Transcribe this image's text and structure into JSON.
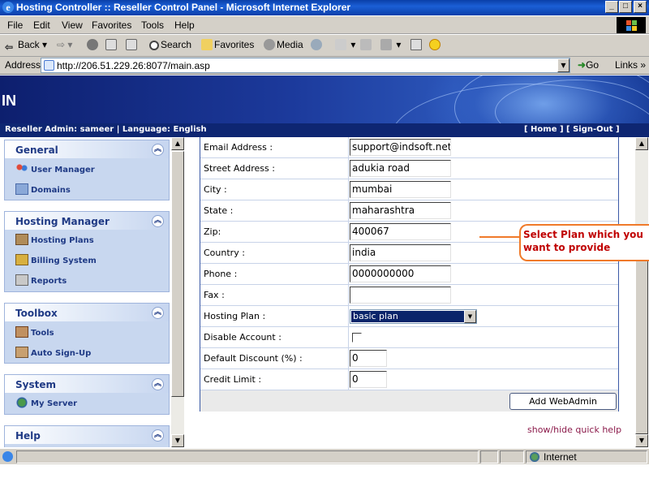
{
  "window": {
    "title": "Hosting Controller :: Reseller Control Panel - Microsoft Internet Explorer",
    "min": "_",
    "max": "□",
    "close": "×"
  },
  "menu": [
    "File",
    "Edit",
    "View",
    "Favorites",
    "Tools",
    "Help"
  ],
  "toolbar": {
    "back": "Back",
    "search": "Search",
    "favorites": "Favorites",
    "media": "Media"
  },
  "address": {
    "label": "Address",
    "url": "http://206.51.229.26:8077/main.asp",
    "go": "Go",
    "links": "Links"
  },
  "banner": {
    "text": "IN",
    "reseller_info": "Reseller Admin: sameer | Language: English",
    "home": "[ Home ]",
    "signout": "[ Sign-Out ]"
  },
  "sidebar": {
    "panels": [
      {
        "title": "General",
        "items": [
          {
            "label": "User Manager",
            "icon": "users-icon"
          },
          {
            "label": "Domains",
            "icon": "domains-icon"
          }
        ]
      },
      {
        "title": "Hosting Manager",
        "items": [
          {
            "label": "Hosting Plans",
            "icon": "hosting-plans-icon"
          },
          {
            "label": "Billing System",
            "icon": "billing-icon"
          },
          {
            "label": "Reports",
            "icon": "reports-icon"
          }
        ]
      },
      {
        "title": "Toolbox",
        "items": [
          {
            "label": "Tools",
            "icon": "tools-icon"
          },
          {
            "label": "Auto Sign-Up",
            "icon": "auto-signup-icon"
          }
        ]
      },
      {
        "title": "System",
        "items": [
          {
            "label": "My Server",
            "icon": "globe-icon"
          }
        ]
      },
      {
        "title": "Help",
        "items": []
      }
    ]
  },
  "form": {
    "fields": [
      {
        "label": "Email Address :",
        "value": "support@indsoft.net"
      },
      {
        "label": "Street Address :",
        "value": "adukia road"
      },
      {
        "label": "City :",
        "value": "mumbai"
      },
      {
        "label": "State :",
        "value": "maharashtra"
      },
      {
        "label": "Zip:",
        "value": "400067"
      },
      {
        "label": "Country :",
        "value": "india"
      },
      {
        "label": "Phone :",
        "value": "0000000000"
      },
      {
        "label": "Fax :",
        "value": ""
      }
    ],
    "hosting_plan_label": "Hosting Plan :",
    "hosting_plan_value": "basic plan",
    "disable_account_label": "Disable Account :",
    "disable_account_checked": false,
    "discount_label": "Default Discount (%) :",
    "discount_value": "0",
    "credit_label": "Credit Limit :",
    "credit_value": "0",
    "submit": "Add WebAdmin"
  },
  "quick_help": "show/hide quick help",
  "callout": {
    "line1": "Select Plan which you",
    "line2": "want to provide"
  },
  "status": {
    "zone": "Internet"
  },
  "colors": {
    "title_bar": "#0a3fa8",
    "banner": "#1c3a9c",
    "sidebar_text": "#1f3a85",
    "callout_border": "#f07a2a",
    "callout_text": "#c00000",
    "quick_help": "#8b1a4a"
  }
}
